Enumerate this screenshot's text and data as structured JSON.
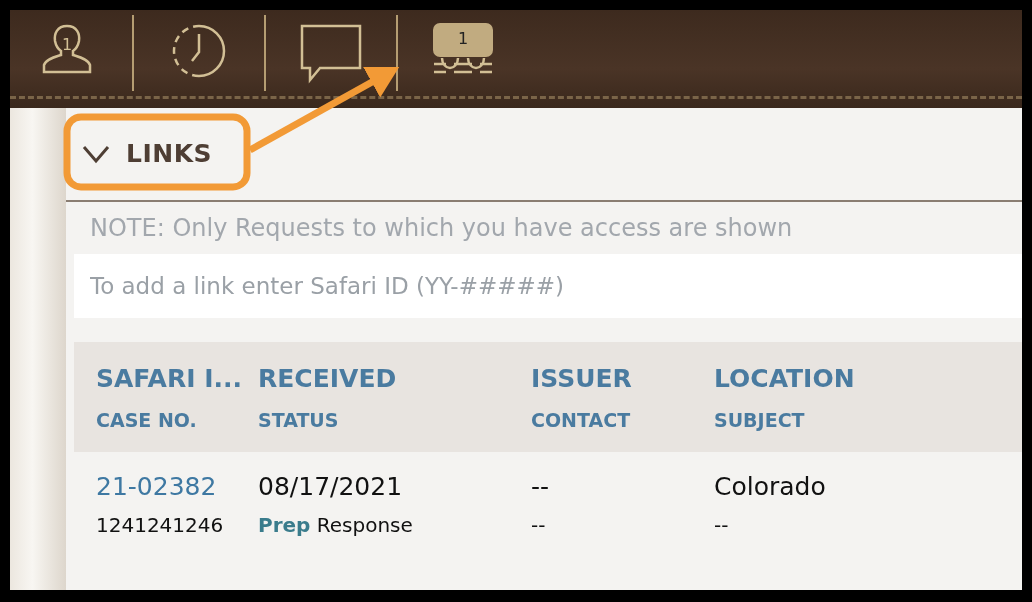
{
  "toolbar": {
    "items": [
      {
        "kind": "person",
        "badge": "1",
        "selected": false
      },
      {
        "kind": "clock",
        "selected": false
      },
      {
        "kind": "chat",
        "selected": false
      },
      {
        "kind": "links",
        "badge": "1",
        "selected": true
      }
    ]
  },
  "section": {
    "title": "LINKS",
    "expanded": true
  },
  "note": "NOTE: Only Requests to which you have access are shown",
  "link_input": {
    "placeholder": "To add a link enter Safari ID (YY-#####)"
  },
  "table": {
    "columns": [
      {
        "title": "SAFARI I...",
        "subtitle": "CASE NO."
      },
      {
        "title": "RECEIVED",
        "subtitle": "STATUS"
      },
      {
        "title": "ISSUER",
        "subtitle": "CONTACT"
      },
      {
        "title": "LOCATION",
        "subtitle": "SUBJECT"
      }
    ],
    "rows": [
      {
        "cells": [
          {
            "kind": "link",
            "main": "21-02382",
            "sub": "1241241246"
          },
          {
            "kind": "status",
            "main": "08/17/2021",
            "tag": "Prep",
            "sub": "Response"
          },
          {
            "kind": "plain",
            "main": "--",
            "sub": "--"
          },
          {
            "kind": "plain",
            "main": "Colorado",
            "sub": "--"
          }
        ]
      }
    ]
  }
}
